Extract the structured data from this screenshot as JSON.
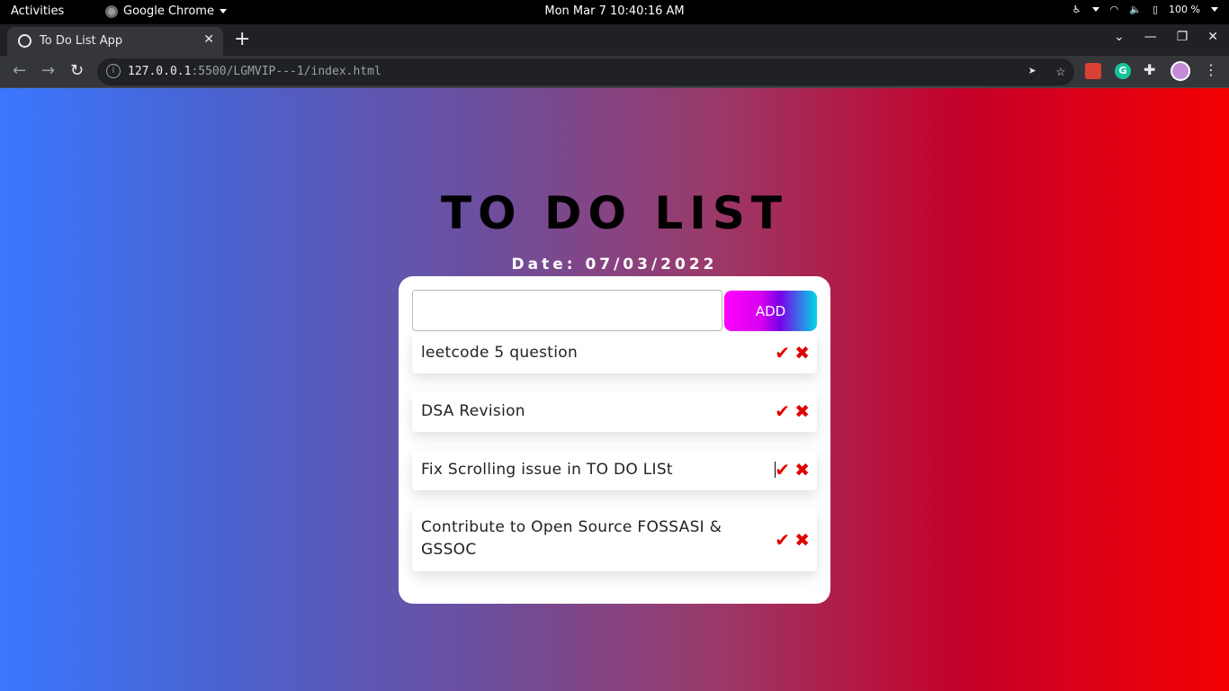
{
  "system_bar": {
    "activities": "Activities",
    "app_name": "Google Chrome",
    "clock": "Mon Mar 7  10:40:16 AM",
    "battery": "100 %"
  },
  "browser": {
    "tab_title": "To Do List App",
    "url_host": "127.0.0.1",
    "url_path": ":5500/LGMVIP---1/index.html"
  },
  "app": {
    "heading": "TO DO LIST",
    "date": "Date: 07/03/2022",
    "input_value": "",
    "add_label": "ADD",
    "tasks": [
      {
        "text": "leetcode 5 question"
      },
      {
        "text": "DSA Revision"
      },
      {
        "text": "Fix Scrolling issue in TO DO LISt"
      },
      {
        "text": "Contribute to Open Source FOSSASI & GSSOC"
      }
    ]
  },
  "colors": {
    "gradient_left": "#3a78ff",
    "gradient_right": "#f20000",
    "action_red": "#e00000"
  }
}
